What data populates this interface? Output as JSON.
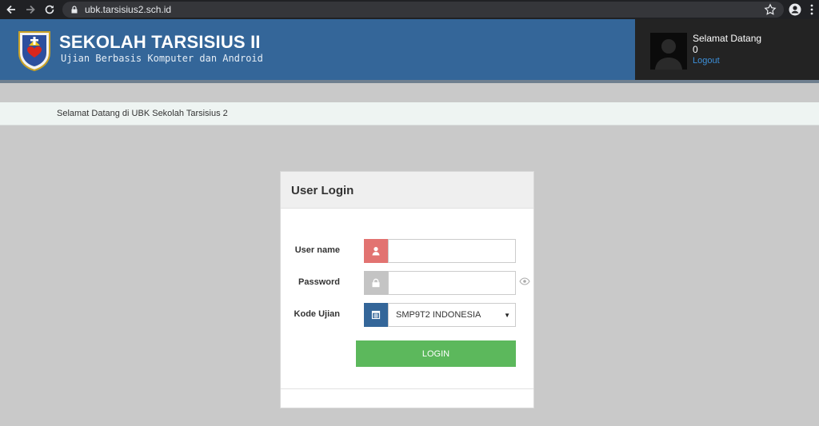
{
  "browser": {
    "url": "ubk.tarsisius2.sch.id",
    "icons": [
      "back-icon",
      "forward-icon",
      "reload-icon",
      "lock-icon",
      "star-icon",
      "account-icon",
      "menu-icon"
    ]
  },
  "header": {
    "title": "SEKOLAH TARSISIUS II",
    "subtitle": "Ujian Berbasis Komputer dan Android",
    "background_color": "#346699"
  },
  "user_panel": {
    "welcome": "Selamat Datang",
    "user_value": "0",
    "logout_label": "Logout"
  },
  "marquee": {
    "text": "Selamat Datang di UBK Sekolah Tarsisius 2"
  },
  "login": {
    "title": "User Login",
    "username_label": "User name",
    "username_value": "",
    "password_label": "Password",
    "password_value": "",
    "exam_code_label": "Kode Ujian",
    "exam_code_selected": "SMP9T2 INDONESIA",
    "button_label": "LOGIN",
    "button_color": "#5cb85c",
    "username_icon_color": "#e27371",
    "password_icon_color": "#c4c4c4",
    "exam_icon_color": "#346699"
  }
}
